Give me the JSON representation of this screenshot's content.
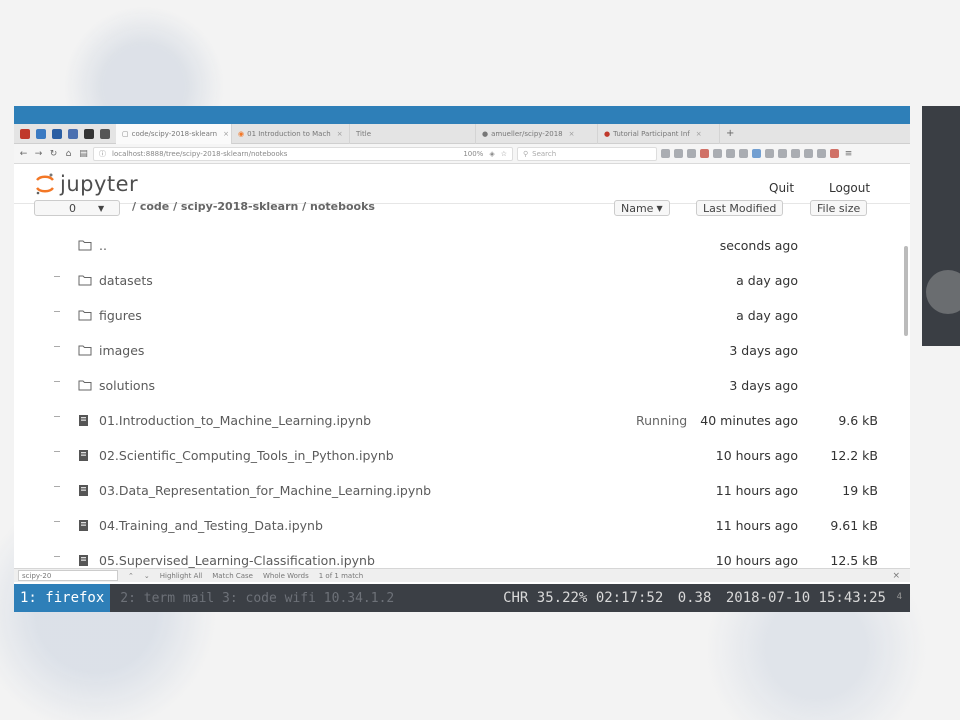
{
  "browser": {
    "tabs": [
      {
        "label": "code/scipy-2018-sklearn",
        "active": true
      },
      {
        "label": "01 Introduction to Mach",
        "active": false
      },
      {
        "label": "Title",
        "active": false
      },
      {
        "label": "amueller/scipy-2018",
        "active": false
      },
      {
        "label": "Tutorial Participant Inf",
        "active": false
      }
    ],
    "new_tab": "+",
    "url": "localhost:8888/tree/scipy-2018-sklearn/notebooks",
    "zoom": "100%",
    "search_placeholder": "Search"
  },
  "jupyter": {
    "logo_text": "jupyter",
    "quit_label": "Quit",
    "logout_label": "Logout",
    "select_count": "0",
    "breadcrumb": "/ code / scipy-2018-sklearn / notebooks",
    "sort_name": "Name",
    "sort_modified": "Last Modified",
    "sort_size": "File size"
  },
  "files": [
    {
      "name": "..",
      "type": "folder",
      "status": "",
      "modified": "seconds ago",
      "size": ""
    },
    {
      "name": "datasets",
      "type": "folder",
      "status": "",
      "modified": "a day ago",
      "size": ""
    },
    {
      "name": "figures",
      "type": "folder",
      "status": "",
      "modified": "a day ago",
      "size": ""
    },
    {
      "name": "images",
      "type": "folder",
      "status": "",
      "modified": "3 days ago",
      "size": ""
    },
    {
      "name": "solutions",
      "type": "folder",
      "status": "",
      "modified": "3 days ago",
      "size": ""
    },
    {
      "name": "01.Introduction_to_Machine_Learning.ipynb",
      "type": "notebook",
      "status": "Running",
      "modified": "40 minutes ago",
      "size": "9.6 kB"
    },
    {
      "name": "02.Scientific_Computing_Tools_in_Python.ipynb",
      "type": "notebook",
      "status": "",
      "modified": "10 hours ago",
      "size": "12.2 kB"
    },
    {
      "name": "03.Data_Representation_for_Machine_Learning.ipynb",
      "type": "notebook",
      "status": "",
      "modified": "11 hours ago",
      "size": "19 kB"
    },
    {
      "name": "04.Training_and_Testing_Data.ipynb",
      "type": "notebook",
      "status": "",
      "modified": "11 hours ago",
      "size": "9.61 kB"
    },
    {
      "name": "05.Supervised_Learning-Classification.ipynb",
      "type": "notebook",
      "status": "",
      "modified": "10 hours ago",
      "size": "12.5 kB"
    }
  ],
  "findbar": {
    "input_value": "scipy-20",
    "highlight": "Highlight All",
    "match_case": "Match Case",
    "whole_words": "Whole Words",
    "result": "1 of 1 match"
  },
  "statusbar": {
    "workspace_active": "1: firefox",
    "workspace_inactive": "2: term  mail  3: code  wifi 10.34.1.2",
    "cpu_label": "CHR 35.22%",
    "uptime": "02:17:52",
    "load": "0.38",
    "datetime": "2018-07-10 15:43:25",
    "tray": "4"
  },
  "colors": {
    "accent": "#2e7fb8",
    "statusbar_bg": "#3b3f45",
    "jupyter_orange": "#f37726"
  }
}
